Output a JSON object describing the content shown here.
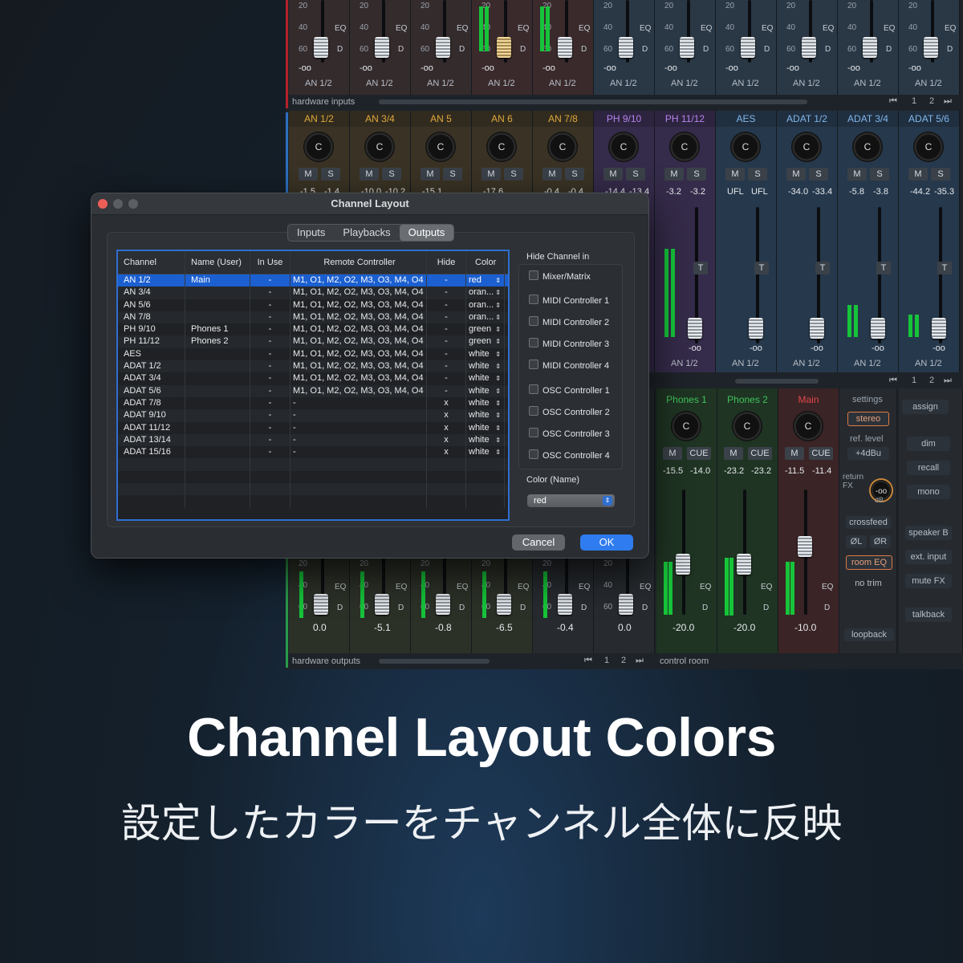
{
  "mixer": {
    "top_row_labels": [
      "AN 1/2",
      "AN 1/2",
      "AN 1/2",
      "AN 1/2",
      "AN 1/2",
      "AN 1/2",
      "AN 1/2",
      "AN 1/2",
      "AN 1/2",
      "AN 1/2",
      "AN 1/2"
    ],
    "top_value": "-oo",
    "hardware_inputs_label": "hardware inputs",
    "pages": [
      "1",
      "2"
    ],
    "input_channels": [
      {
        "name": "AN 1/2",
        "color": "#e0a83a",
        "bg": "#3a3325",
        "l": "-1.5",
        "r": "-1.4"
      },
      {
        "name": "AN 3/4",
        "color": "#e0a83a",
        "bg": "#3a3325",
        "l": "-10.0",
        "r": "-10.2"
      },
      {
        "name": "AN 5",
        "color": "#e0a83a",
        "bg": "#3a3325",
        "l": "-15.1",
        "r": ""
      },
      {
        "name": "AN 6",
        "color": "#e0a83a",
        "bg": "#3a3325",
        "l": "-17.6",
        "r": ""
      },
      {
        "name": "AN 7/8",
        "color": "#e0a83a",
        "bg": "#3a3325",
        "l": "-0.4",
        "r": "-0.4"
      },
      {
        "name": "PH 9/10",
        "color": "#b684f0",
        "bg": "#352b4a",
        "l": "-14.4",
        "r": "-13.4"
      },
      {
        "name": "PH 11/12",
        "color": "#b684f0",
        "bg": "#352b4a",
        "l": "-3.2",
        "r": "-3.2"
      },
      {
        "name": "AES",
        "color": "#7fb6ea",
        "bg": "#26384c",
        "l": "UFL",
        "r": "UFL"
      },
      {
        "name": "ADAT 1/2",
        "color": "#7fb6ea",
        "bg": "#26384c",
        "l": "-34.0",
        "r": "-33.4"
      },
      {
        "name": "ADAT 3/4",
        "color": "#7fb6ea",
        "bg": "#26384c",
        "l": "-5.8",
        "r": "-3.8"
      },
      {
        "name": "ADAT 5/6",
        "color": "#7fb6ea",
        "bg": "#26384c",
        "l": "-44.2",
        "r": "-35.3"
      }
    ],
    "mid_row_labels": [
      "AN 1/2",
      "AN 1/2",
      "AN 1/2",
      "AN 1/2",
      "AN 1/2"
    ],
    "output_values": [
      "0.0",
      "-5.1",
      "-0.8",
      "-6.5",
      "-0.4",
      "0.0"
    ],
    "phones": [
      {
        "name": "Phones 1",
        "l": "-15.5",
        "r": "-14.0",
        "val": "-20.0",
        "color": "#3fc45a",
        "bg": "#1f3423"
      },
      {
        "name": "Phones 2",
        "l": "-23.2",
        "r": "-23.2",
        "val": "-20.0",
        "color": "#3fc45a",
        "bg": "#1f3423"
      },
      {
        "name": "Main",
        "l": "-11.5",
        "r": "-11.4",
        "val": "-10.0",
        "color": "#e04848",
        "bg": "#3b2426"
      }
    ],
    "hardware_outputs_label": "hardware outputs",
    "control_room_label": "control room",
    "buttons": {
      "m": "M",
      "s": "S",
      "cue": "CUE",
      "eq": "EQ",
      "d": "D",
      "t": "T",
      "c": "C"
    },
    "room": {
      "settings": "settings",
      "stereo": "stereo",
      "ref_level": "ref. level",
      "ref_value": "+4dBu",
      "return_fx": "return FX",
      "return_value": "-oo",
      "return_unit": "dB",
      "crossfeed": "crossfeed",
      "phase_l": "ØL",
      "phase_r": "ØR",
      "room_eq": "room EQ",
      "no_trim": "no trim",
      "loopback": "loopback",
      "assign": "assign",
      "dim": "dim",
      "recall": "recall",
      "mono": "mono",
      "speaker_b": "speaker B",
      "ext_input": "ext. input",
      "mute_fx": "mute FX",
      "talkback": "talkback"
    },
    "scale": [
      "20",
      "40",
      "60"
    ]
  },
  "dialog": {
    "title": "Channel Layout",
    "tabs": [
      "Inputs",
      "Playbacks",
      "Outputs"
    ],
    "active_tab": "Outputs",
    "columns": [
      "Channel",
      "Name (User)",
      "In Use",
      "Remote Controller",
      "Hide",
      "Color"
    ],
    "rows": [
      {
        "channel": "AN 1/2",
        "name": "Main",
        "inuse": "-",
        "remote": "M1, O1, M2, O2, M3, O3, M4, O4",
        "hide": "-",
        "color": "red"
      },
      {
        "channel": "AN 3/4",
        "name": "",
        "inuse": "-",
        "remote": "M1, O1, M2, O2, M3, O3, M4, O4",
        "hide": "-",
        "color": "oran..."
      },
      {
        "channel": "AN 5/6",
        "name": "",
        "inuse": "-",
        "remote": "M1, O1, M2, O2, M3, O3, M4, O4",
        "hide": "-",
        "color": "oran..."
      },
      {
        "channel": "AN 7/8",
        "name": "",
        "inuse": "-",
        "remote": "M1, O1, M2, O2, M3, O3, M4, O4",
        "hide": "-",
        "color": "oran..."
      },
      {
        "channel": "PH 9/10",
        "name": "Phones 1",
        "inuse": "-",
        "remote": "M1, O1, M2, O2, M3, O3, M4, O4",
        "hide": "-",
        "color": "green"
      },
      {
        "channel": "PH 11/12",
        "name": "Phones 2",
        "inuse": "-",
        "remote": "M1, O1, M2, O2, M3, O3, M4, O4",
        "hide": "-",
        "color": "green"
      },
      {
        "channel": "AES",
        "name": "",
        "inuse": "-",
        "remote": "M1, O1, M2, O2, M3, O3, M4, O4",
        "hide": "-",
        "color": "white"
      },
      {
        "channel": "ADAT 1/2",
        "name": "",
        "inuse": "-",
        "remote": "M1, O1, M2, O2, M3, O3, M4, O4",
        "hide": "-",
        "color": "white"
      },
      {
        "channel": "ADAT 3/4",
        "name": "",
        "inuse": "-",
        "remote": "M1, O1, M2, O2, M3, O3, M4, O4",
        "hide": "-",
        "color": "white"
      },
      {
        "channel": "ADAT 5/6",
        "name": "",
        "inuse": "-",
        "remote": "M1, O1, M2, O2, M3, O3, M4, O4",
        "hide": "-",
        "color": "white"
      },
      {
        "channel": "ADAT 7/8",
        "name": "",
        "inuse": "-",
        "remote": "-",
        "hide": "x",
        "color": "white"
      },
      {
        "channel": "ADAT 9/10",
        "name": "",
        "inuse": "-",
        "remote": "-",
        "hide": "x",
        "color": "white"
      },
      {
        "channel": "ADAT 11/12",
        "name": "",
        "inuse": "-",
        "remote": "-",
        "hide": "x",
        "color": "white"
      },
      {
        "channel": "ADAT 13/14",
        "name": "",
        "inuse": "-",
        "remote": "-",
        "hide": "x",
        "color": "white"
      },
      {
        "channel": "ADAT 15/16",
        "name": "",
        "inuse": "-",
        "remote": "-",
        "hide": "x",
        "color": "white"
      }
    ],
    "hide_title": "Hide Channel in",
    "hide_options": [
      "Mixer/Matrix",
      "MIDI Controller 1",
      "MIDI Controller 2",
      "MIDI Controller 3",
      "MIDI Controller 4",
      "OSC Controller 1",
      "OSC Controller 2",
      "OSC Controller 3",
      "OSC Controller 4"
    ],
    "color_label": "Color (Name)",
    "color_value": "red",
    "cancel": "Cancel",
    "ok": "OK"
  },
  "headline": "Channel Layout Colors",
  "subline": "設定したカラーをチャンネル全体に反映"
}
